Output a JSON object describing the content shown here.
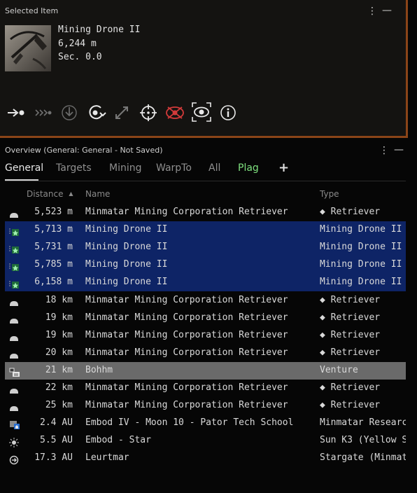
{
  "selected_item": {
    "panel_title": "Selected Item",
    "name": "Mining Drone II",
    "distance": "6,244 m",
    "security": "Sec. 0.0"
  },
  "overview": {
    "panel_title": "Overview (General: General - Not Saved)",
    "tabs": [
      "General",
      "Targets",
      "Mining",
      "WarpTo",
      "All",
      "Plag"
    ],
    "add_tab_label": "+",
    "columns": {
      "distance": "Distance",
      "name": "Name",
      "type": "Type"
    },
    "rows": [
      {
        "distance": "5,523 m",
        "name": "Minmatar Mining Corporation Retriever",
        "type": "◆ Retriever",
        "icon": "ship-icon",
        "state": ""
      },
      {
        "distance": "5,713 m",
        "name": "Mining Drone II",
        "type": "Mining Drone II",
        "icon": "drone-icon",
        "state": "sel"
      },
      {
        "distance": "5,731 m",
        "name": "Mining Drone II",
        "type": "Mining Drone II",
        "icon": "drone-icon",
        "state": "sel"
      },
      {
        "distance": "5,785 m",
        "name": "Mining Drone II",
        "type": "Mining Drone II",
        "icon": "drone-icon",
        "state": "sel"
      },
      {
        "distance": "6,158 m",
        "name": "Mining Drone II",
        "type": "Mining Drone II",
        "icon": "drone-icon",
        "state": "sel"
      },
      {
        "distance": "18 km",
        "name": "Minmatar Mining Corporation Retriever",
        "type": "◆ Retriever",
        "icon": "ship-icon",
        "state": ""
      },
      {
        "distance": "19 km",
        "name": "Minmatar Mining Corporation Retriever",
        "type": "◆ Retriever",
        "icon": "ship-icon",
        "state": ""
      },
      {
        "distance": "19 km",
        "name": "Minmatar Mining Corporation Retriever",
        "type": "◆ Retriever",
        "icon": "ship-icon",
        "state": ""
      },
      {
        "distance": "20 km",
        "name": "Minmatar Mining Corporation Retriever",
        "type": "◆ Retriever",
        "icon": "ship-icon",
        "state": ""
      },
      {
        "distance": "21 km",
        "name": "Bohhm",
        "type": "Venture",
        "icon": "player-ship-icon",
        "state": "hl"
      },
      {
        "distance": "22 km",
        "name": "Minmatar Mining Corporation Retriever",
        "type": "◆ Retriever",
        "icon": "ship-icon",
        "state": ""
      },
      {
        "distance": "25 km",
        "name": "Minmatar Mining Corporation Retriever",
        "type": "◆ Retriever",
        "icon": "ship-icon",
        "state": ""
      },
      {
        "distance": "2.4 AU",
        "name": "Embod IV - Moon 10 - Pator Tech School",
        "type": "Minmatar Researcl",
        "icon": "station-icon",
        "state": ""
      },
      {
        "distance": "5.5 AU",
        "name": "Embod - Star",
        "type": "Sun K3 (Yellow S",
        "icon": "star-icon",
        "state": ""
      },
      {
        "distance": "17.3 AU",
        "name": "Leurtmar",
        "type": "Stargate (Minmata",
        "icon": "stargate-icon",
        "state": ""
      }
    ]
  },
  "colors": {
    "accent_border": "#8a4418",
    "selected_row": "#0e2466",
    "highlight_row": "#6a6a6a",
    "active_tab_green": "#7ee07e",
    "hostile_red": "#d23a3a"
  }
}
